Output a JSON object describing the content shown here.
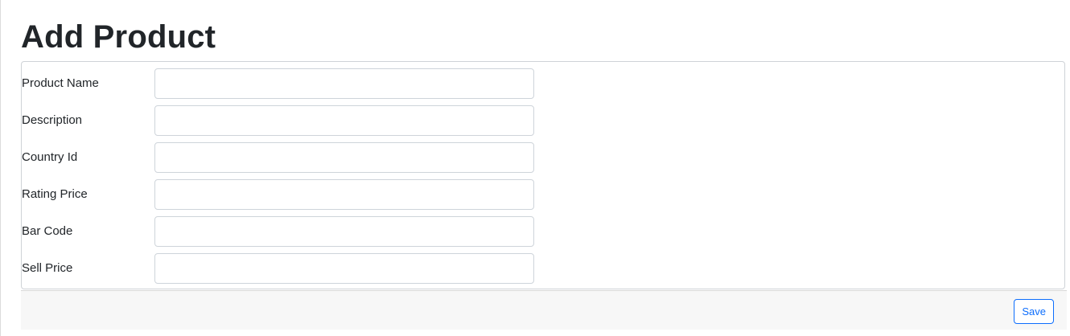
{
  "page": {
    "title": "Add Product"
  },
  "form": {
    "fields": [
      {
        "label": "Product Name",
        "value": "",
        "placeholder": ""
      },
      {
        "label": "Description",
        "value": "",
        "placeholder": ""
      },
      {
        "label": "Country Id",
        "value": "",
        "placeholder": ""
      },
      {
        "label": "Rating Price",
        "value": "",
        "placeholder": ""
      },
      {
        "label": "Bar Code",
        "value": "",
        "placeholder": ""
      },
      {
        "label": "Sell Price",
        "value": "",
        "placeholder": ""
      }
    ]
  },
  "footer": {
    "save_label": "Save"
  },
  "colors": {
    "primary": "#0d6efd",
    "border": "#ced4da",
    "footer_bg": "#f7f7f7",
    "text": "#212529"
  }
}
